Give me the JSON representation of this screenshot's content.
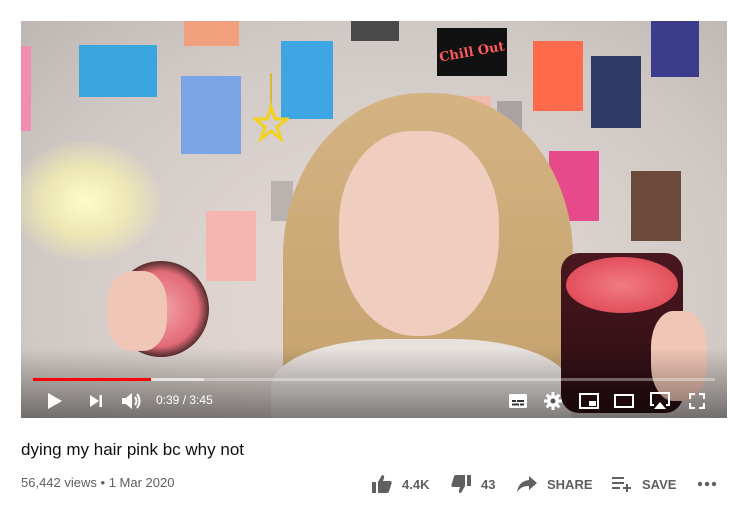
{
  "video": {
    "title": "dying my hair pink bc why not",
    "views": "56,442 views",
    "separator": "•",
    "date": "1 Mar 2020"
  },
  "player": {
    "current_time": "0:39",
    "time_separator": "/",
    "duration": "3:45",
    "played_fraction": 0.173,
    "loaded_fraction": 0.25,
    "accent_color": "#ff0000",
    "controls": [
      "play-icon",
      "next-icon",
      "volume-icon",
      "subtitles-icon",
      "gear-icon",
      "miniplayer-icon",
      "theater-icon",
      "airplay-icon",
      "fullscreen-icon"
    ]
  },
  "actions": {
    "like_count": "4.4K",
    "dislike_count": "43",
    "share_label": "SHARE",
    "save_label": "SAVE",
    "more_icon": "more-horizontal-icon"
  },
  "poster_text": {
    "chill": "Chill Out"
  }
}
